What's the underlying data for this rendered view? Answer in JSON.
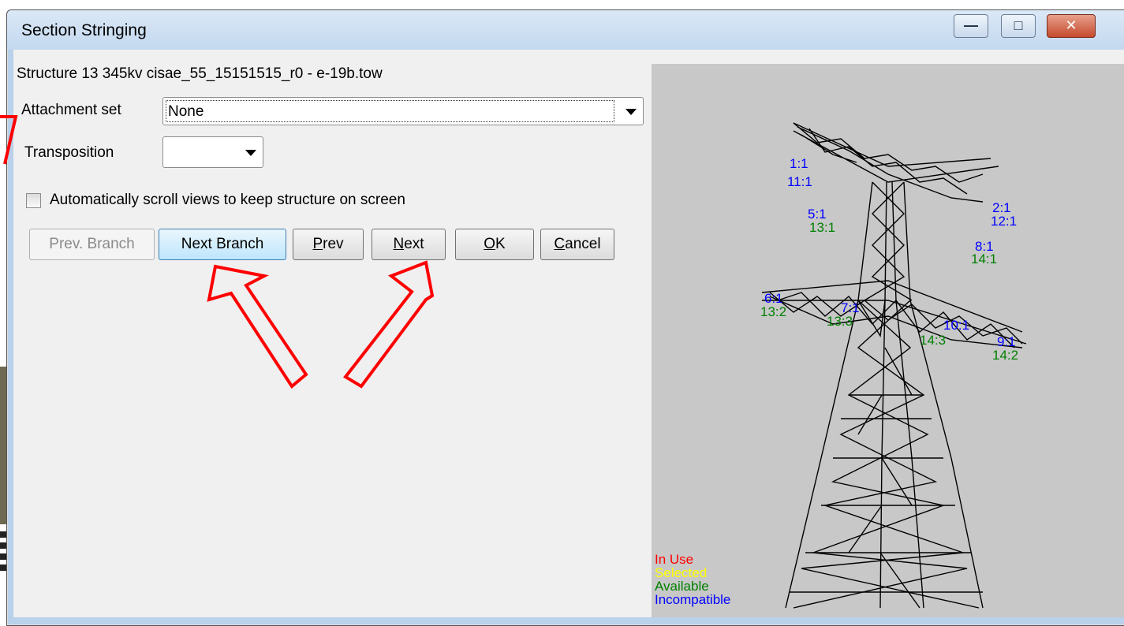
{
  "window": {
    "title": "Section Stringing",
    "controls": {
      "minimize": "minimize",
      "maximize": "maximize",
      "close": "close"
    }
  },
  "structure": {
    "label": "Structure 13 345kv cisae_55_15151515_r0 - e-19b.tow"
  },
  "attachment_set": {
    "label": "Attachment set",
    "value": "None"
  },
  "transposition": {
    "label": "Transposition",
    "value": ""
  },
  "auto_scroll": {
    "label": "Automatically scroll views to keep structure on screen",
    "checked": false
  },
  "buttons": {
    "prev_branch": "Prev. Branch",
    "next_branch": "Next Branch",
    "prev": {
      "mnemonic": "P",
      "rest": "rev"
    },
    "next": {
      "mnemonic": "N",
      "rest": "ext"
    },
    "ok": {
      "mnemonic": "O",
      "rest": "K"
    },
    "cancel": {
      "mnemonic": "C",
      "rest": "ancel"
    }
  },
  "tower_labels": [
    {
      "blue": "1:1",
      "green": "11:1"
    },
    {
      "blue": "2:1",
      "green": "12:1"
    },
    {
      "blue": "5:1",
      "green": "13:1"
    },
    {
      "blue": "8:1",
      "green": "14:1"
    },
    {
      "blue": "6:1",
      "green": "13:2"
    },
    {
      "blue": "7:1",
      "green": "13:3"
    },
    {
      "blue": "10:1",
      "green": "14:3"
    },
    {
      "blue": "9:1",
      "green": "14:2"
    }
  ],
  "legend": {
    "in_use": "In Use",
    "selected": "Selected",
    "available": "Available",
    "incompatible": "Incompatible"
  },
  "colors": {
    "in_use": "#ff0000",
    "selected": "#ffff00",
    "available": "#008000",
    "incompatible": "#0000ff",
    "annotation_arrow": "#ff0000"
  }
}
